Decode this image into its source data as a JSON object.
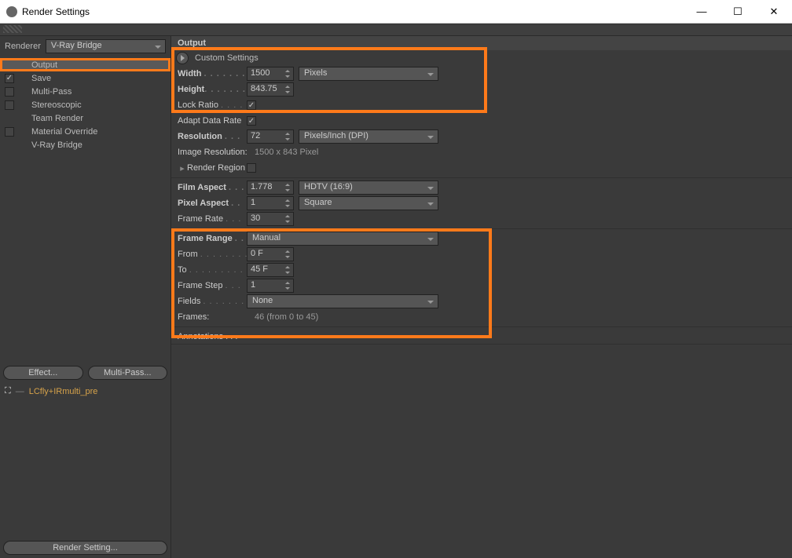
{
  "window": {
    "title": "Render Settings"
  },
  "renderer": {
    "label": "Renderer",
    "value": "V-Ray Bridge"
  },
  "tree": {
    "output": "Output",
    "save": "Save",
    "multipass": "Multi-Pass",
    "stereoscopic": "Stereoscopic",
    "teamrender": "Team Render",
    "matoverride": "Material Override",
    "vraybridge": "V-Ray Bridge"
  },
  "buttons": {
    "effect": "Effect...",
    "multipass": "Multi-Pass...",
    "render_setting": "Render Setting..."
  },
  "preset": {
    "name": "LCfly+IRmulti_pre"
  },
  "output": {
    "header": "Output",
    "custom_settings": "Custom Settings",
    "width_label": "Width",
    "width_value": "1500",
    "width_unit": "Pixels",
    "height_label": "Height",
    "height_value": "843.75",
    "lockratio_label": "Lock Ratio",
    "adaptdatarate_label": "Adapt Data Rate",
    "resolution_label": "Resolution",
    "resolution_value": "72",
    "resolution_unit": "Pixels/Inch (DPI)",
    "imgres_label": "Image Resolution:",
    "imgres_value": "1500 x 843 Pixel",
    "renderregion_label": "Render Region",
    "filmaspect_label": "Film Aspect",
    "filmaspect_value": "1.778",
    "filmaspect_unit": "HDTV (16:9)",
    "pixelaspect_label": "Pixel Aspect",
    "pixelaspect_value": "1",
    "pixelaspect_unit": "Square",
    "framerate_label": "Frame Rate",
    "framerate_value": "30",
    "framerange_label": "Frame Range",
    "framerange_value": "Manual",
    "from_label": "From",
    "from_value": "0 F",
    "to_label": "To",
    "to_value": "45 F",
    "framestep_label": "Frame Step",
    "framestep_value": "1",
    "fields_label": "Fields",
    "fields_value": "None",
    "frames_label": "Frames:",
    "frames_value": "46 (from 0 to 45)",
    "annotations_label": "Annotations"
  }
}
